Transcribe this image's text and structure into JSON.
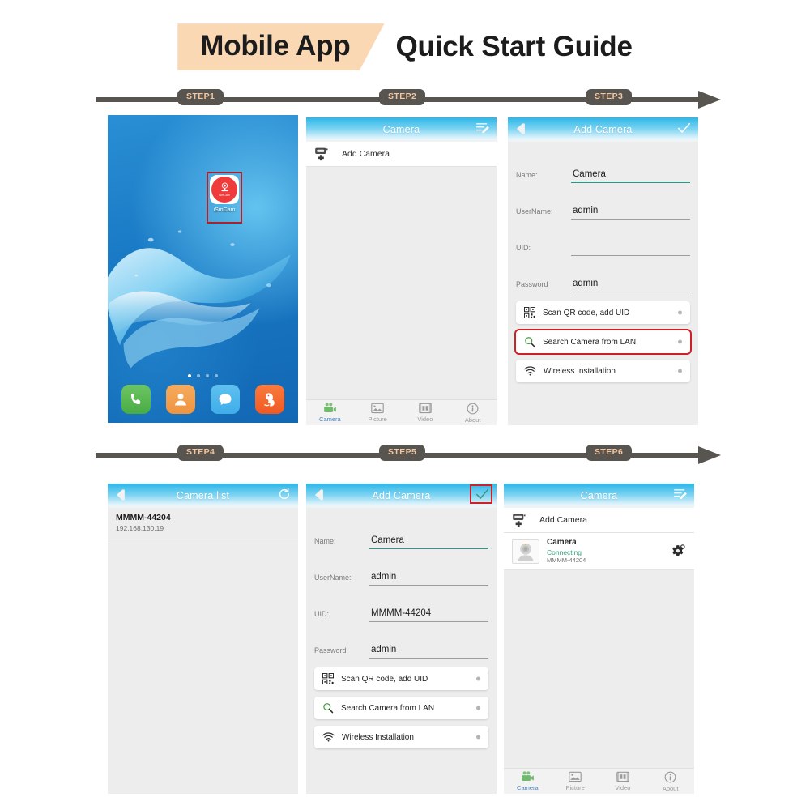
{
  "header": {
    "badge_label": "Mobile App",
    "title": "Quick Start Guide",
    "badge_color": "#fbd8b4"
  },
  "steps": {
    "row1": [
      "STEP1",
      "STEP2",
      "STEP3"
    ],
    "row2": [
      "STEP4",
      "STEP5",
      "STEP6"
    ],
    "pill_bg": "#585450",
    "pill_text_color": "#f2c6a0"
  },
  "step1": {
    "screen_type": "android-home-screen",
    "app_icon_label": "iSmCam",
    "app_icon_inner_text": "iSmCam",
    "highlight_color": "#b02028",
    "dock": [
      {
        "name": "phone-dock-icon",
        "color": "#4db04a"
      },
      {
        "name": "contacts-dock-icon",
        "color": "#ef9440"
      },
      {
        "name": "messages-dock-icon",
        "color": "#3fadea"
      },
      {
        "name": "uc-browser-dock-icon",
        "color": "#f05a22"
      }
    ],
    "page_dots": 4,
    "active_dot": 1
  },
  "step2": {
    "header_title": "Camera",
    "header_right_icon": "edit-list-icon",
    "add_camera_label": "Add Camera",
    "camera_items": [],
    "tabs": [
      {
        "label": "Camera",
        "icon": "camcorder-icon",
        "active": true
      },
      {
        "label": "Picture",
        "icon": "photo-icon",
        "active": false
      },
      {
        "label": "Video",
        "icon": "film-icon",
        "active": false
      },
      {
        "label": "About",
        "icon": "info-icon",
        "active": false
      }
    ]
  },
  "step3": {
    "header_title": "Add Camera",
    "header_left_icon": "back-arrow-icon",
    "header_right_icon": "check-icon",
    "fields": [
      {
        "label": "Name:",
        "value": "Camera",
        "active": true
      },
      {
        "label": "UserName:",
        "value": "admin",
        "active": false
      },
      {
        "label": "UID:",
        "value": "",
        "active": false
      },
      {
        "label": "Password",
        "value": "admin",
        "active": false
      }
    ],
    "actions": [
      {
        "label": "Scan QR code, add UID",
        "icon": "qr-code-icon",
        "highlighted": false
      },
      {
        "label": "Search Camera from LAN",
        "icon": "search-icon",
        "highlighted": true
      },
      {
        "label": "Wireless Installation",
        "icon": "wifi-icon",
        "highlighted": false
      }
    ],
    "highlight_color": "#cf2026"
  },
  "step4": {
    "header_title": "Camera list",
    "header_left_icon": "back-arrow-icon",
    "header_right_icon": "refresh-icon",
    "results": [
      {
        "uid": "MMMM-44204",
        "ip": "192.168.130.19"
      }
    ]
  },
  "step5": {
    "header_title": "Add Camera",
    "header_left_icon": "back-arrow-icon",
    "header_right_icon": "check-icon",
    "header_right_highlighted": true,
    "fields": [
      {
        "label": "Name:",
        "value": "Camera",
        "active": true
      },
      {
        "label": "UserName:",
        "value": "admin",
        "active": false
      },
      {
        "label": "UID:",
        "value": "MMMM-44204",
        "active": false
      },
      {
        "label": "Password",
        "value": "admin",
        "active": false
      }
    ],
    "actions": [
      {
        "label": "Scan QR code, add UID",
        "icon": "qr-code-icon",
        "highlighted": false
      },
      {
        "label": "Search Camera from LAN",
        "icon": "search-icon",
        "highlighted": false
      },
      {
        "label": "Wireless Installation",
        "icon": "wifi-icon",
        "highlighted": false
      }
    ],
    "highlight_color": "#cf2026"
  },
  "step6": {
    "header_title": "Camera",
    "header_right_icon": "edit-list-icon",
    "add_camera_label": "Add Camera",
    "camera_items": [
      {
        "name": "Camera",
        "status": "Connecting",
        "uid": "MMMM-44204",
        "status_color": "#3aa37f"
      }
    ],
    "settings_icon": "gear-icon",
    "tabs": [
      {
        "label": "Camera",
        "icon": "camcorder-icon",
        "active": true
      },
      {
        "label": "Picture",
        "icon": "photo-icon",
        "active": false
      },
      {
        "label": "Video",
        "icon": "film-icon",
        "active": false
      },
      {
        "label": "About",
        "icon": "info-icon",
        "active": false
      }
    ]
  }
}
